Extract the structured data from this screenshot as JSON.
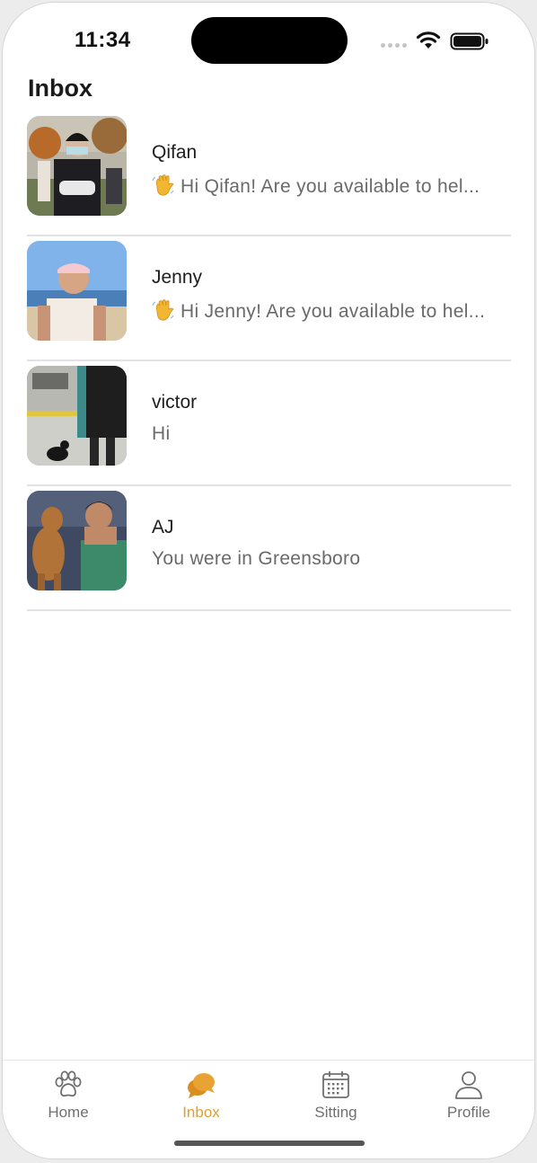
{
  "status_bar": {
    "time": "11:34"
  },
  "header": {
    "title": "Inbox"
  },
  "conversations": [
    {
      "name": "Qifan",
      "preview": "Hi Qifan! Are you available to hel...",
      "has_wave_emoji": true
    },
    {
      "name": "Jenny",
      "preview": "Hi Jenny! Are you available to hel...",
      "has_wave_emoji": true
    },
    {
      "name": "victor",
      "preview": "Hi",
      "has_wave_emoji": false
    },
    {
      "name": "AJ",
      "preview": "You were in Greensboro",
      "has_wave_emoji": false
    }
  ],
  "tab_bar": {
    "tabs": [
      {
        "label": "Home",
        "icon": "paw-icon",
        "active": false
      },
      {
        "label": "Inbox",
        "icon": "chat-bubbles-icon",
        "active": true
      },
      {
        "label": "Sitting",
        "icon": "calendar-icon",
        "active": false
      },
      {
        "label": "Profile",
        "icon": "person-icon",
        "active": false
      }
    ]
  },
  "colors": {
    "accent": "#e0a030",
    "inactive_tab": "#707070",
    "preview_text": "#6a6a6a",
    "divider": "#e2e2e2"
  }
}
